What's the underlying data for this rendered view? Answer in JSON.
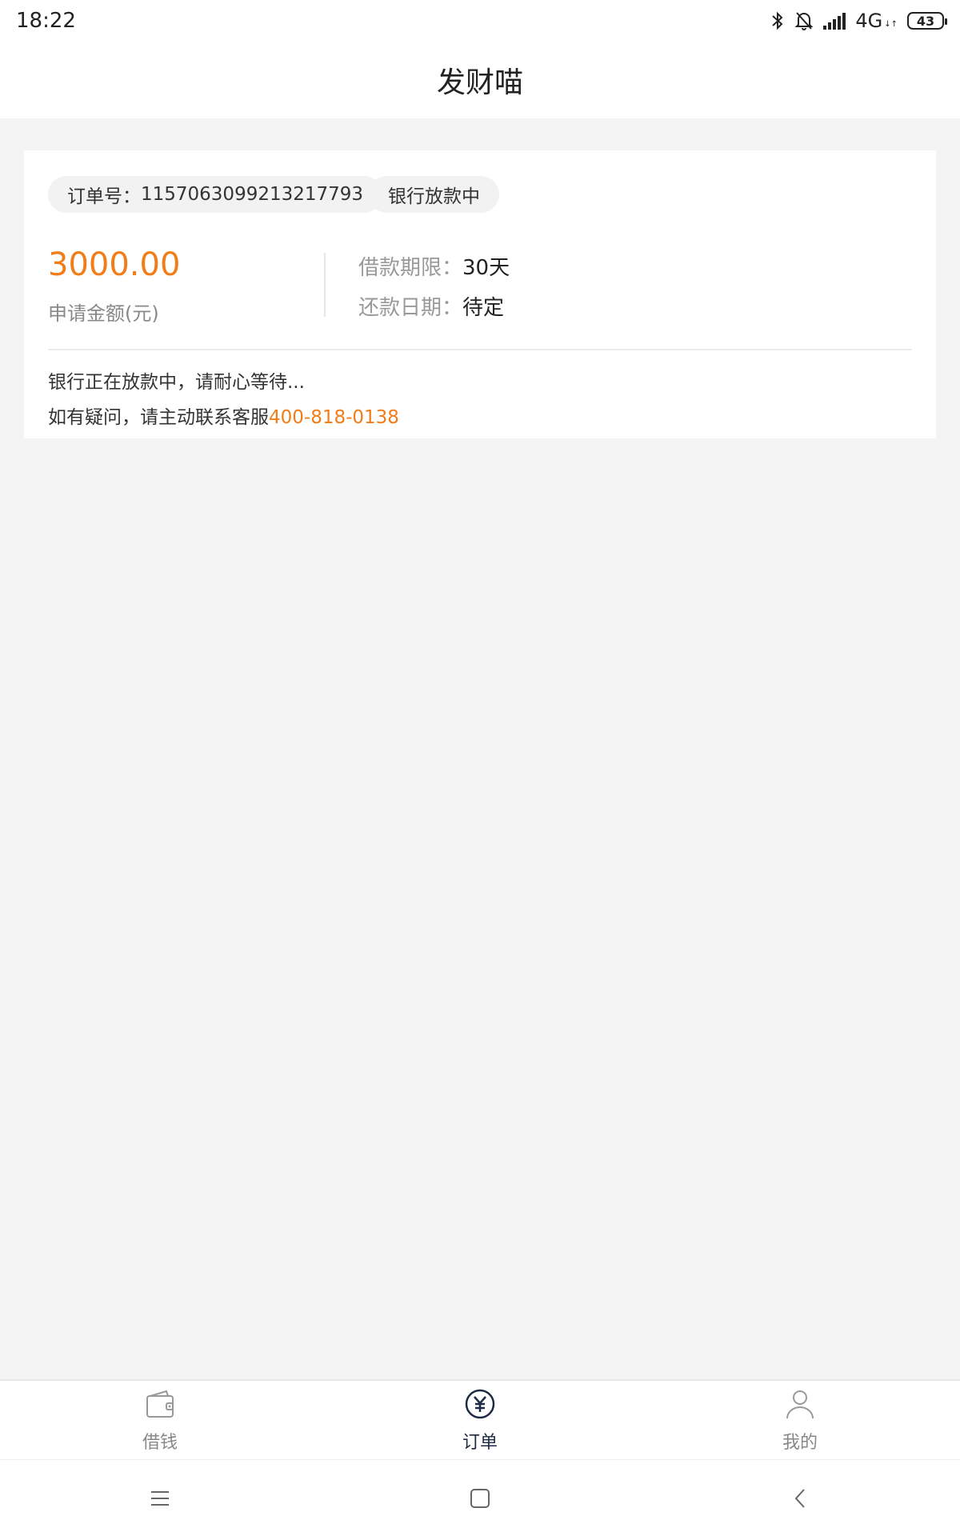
{
  "status_bar": {
    "time": "18:22",
    "network": "4G",
    "network_sub": "↓↑",
    "battery": "43"
  },
  "header": {
    "title": "发财喵"
  },
  "order": {
    "order_no_label": "订单号：",
    "order_no": "1157063099213217793",
    "status": "银行放款中",
    "amount": "3000.00",
    "amount_label": "申请金额(元)",
    "term_label": "借款期限：",
    "term_value": "30天",
    "date_label": "还款日期：",
    "date_value": "待定",
    "message": "银行正在放款中，请耐心等待...",
    "contact_prefix": "如有疑问，请主动联系客服",
    "phone": "400-818-0138"
  },
  "tabs": [
    {
      "label": "借钱",
      "icon": "wallet-icon",
      "active": false
    },
    {
      "label": "订单",
      "icon": "yuan-circle-icon",
      "active": true
    },
    {
      "label": "我的",
      "icon": "person-icon",
      "active": false
    }
  ],
  "colors": {
    "accent": "#f07d18",
    "active_tab": "#1e2a44",
    "inactive_tab": "#888888",
    "background": "#f4f4f4"
  }
}
